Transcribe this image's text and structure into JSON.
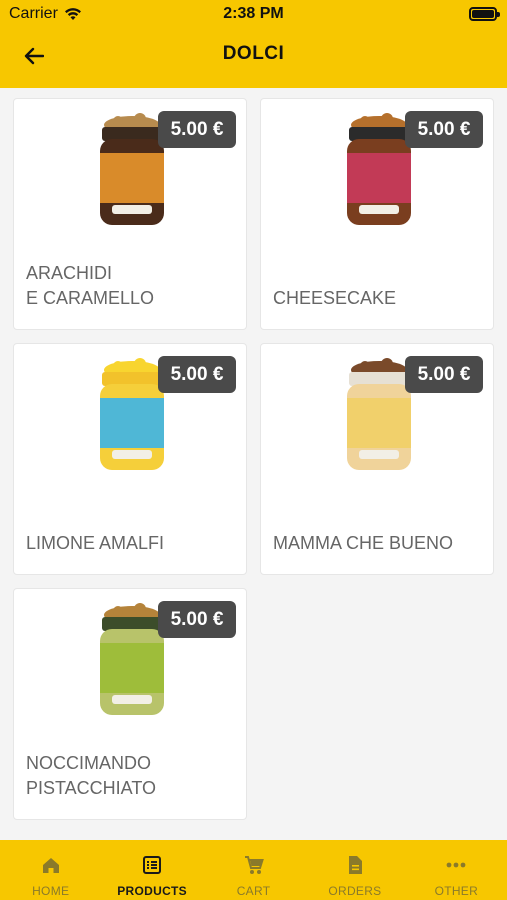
{
  "status_bar": {
    "carrier": "Carrier",
    "time": "2:38 PM"
  },
  "header": {
    "title": "DOLCI"
  },
  "products": [
    {
      "name": "ARACHIDI\nE CARAMELLO",
      "price": "5.00 €",
      "icon": "jar-arachidi-caramello",
      "jar_colors": {
        "lid": "#3a2a1e",
        "label": "#d98b2a",
        "body": "#4a2b1a",
        "topping": "#b78b4e"
      }
    },
    {
      "name": "CHEESECAKE",
      "price": "5.00 €",
      "icon": "jar-cheesecake",
      "jar_colors": {
        "lid": "#2b2b2b",
        "label": "#c23a56",
        "body": "#7a3e1f",
        "topping": "#b5702c"
      }
    },
    {
      "name": "LIMONE AMALFI",
      "price": "5.00 €",
      "icon": "jar-limone-amalfi",
      "jar_colors": {
        "lid": "#f2c22b",
        "label": "#4fb7d6",
        "body": "#f5cf3a",
        "topping": "#f8d52f"
      }
    },
    {
      "name": "MAMMA CHE BUENO",
      "price": "5.00 €",
      "icon": "jar-mamma-che-bueno",
      "jar_colors": {
        "lid": "#e6e0d4",
        "label": "#f1d06b",
        "body": "#f0d39a",
        "topping": "#7a4a2a"
      }
    },
    {
      "name": "NOCCIMANDO\nPISTACCHIATO",
      "price": "5.00 €",
      "icon": "jar-noccimando-pistacchiato",
      "jar_colors": {
        "lid": "#3c4d2a",
        "label": "#9ebd3a",
        "body": "#b8c36a",
        "topping": "#b5833a"
      }
    }
  ],
  "tab_bar": {
    "tabs": [
      {
        "label": "HOME",
        "icon": "home-icon",
        "active": false
      },
      {
        "label": "PRODUCTS",
        "icon": "list-icon",
        "active": true
      },
      {
        "label": "CART",
        "icon": "cart-icon",
        "active": false
      },
      {
        "label": "ORDERS",
        "icon": "document-icon",
        "active": false
      },
      {
        "label": "OTHER",
        "icon": "more-icon",
        "active": false
      }
    ]
  },
  "colors": {
    "accent": "#f7c700",
    "price_tag": "#4a4a4a",
    "tab_inactive": "#8a7a2a",
    "tab_active": "#1a1a1a"
  }
}
